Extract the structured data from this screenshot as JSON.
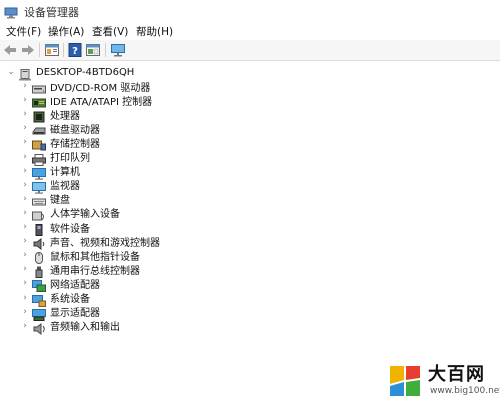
{
  "window": {
    "title": "设备管理器"
  },
  "menu": [
    "文件(F)",
    "操作(A)",
    "查看(V)",
    "帮助(H)"
  ],
  "toolbar": [
    "back-arrow-icon",
    "forward-arrow-icon",
    "properties-icon",
    "help-icon",
    "show-hide-icon",
    "monitor-icon"
  ],
  "tree": {
    "root": "DESKTOP-4BTD6QH",
    "items": [
      {
        "label": "DVD/CD-ROM 驱动器",
        "icon": "dvd-drive-icon"
      },
      {
        "label": "IDE ATA/ATAPI 控制器",
        "icon": "ide-controller-icon"
      },
      {
        "label": "处理器",
        "icon": "processor-icon"
      },
      {
        "label": "磁盘驱动器",
        "icon": "disk-drive-icon"
      },
      {
        "label": "存储控制器",
        "icon": "storage-controller-icon"
      },
      {
        "label": "打印队列",
        "icon": "printer-icon"
      },
      {
        "label": "计算机",
        "icon": "computer-icon"
      },
      {
        "label": "监视器",
        "icon": "monitor-icon"
      },
      {
        "label": "键盘",
        "icon": "keyboard-icon"
      },
      {
        "label": "人体学输入设备",
        "icon": "hid-icon"
      },
      {
        "label": "软件设备",
        "icon": "software-device-icon"
      },
      {
        "label": "声音、视频和游戏控制器",
        "icon": "speaker-icon"
      },
      {
        "label": "鼠标和其他指针设备",
        "icon": "mouse-icon"
      },
      {
        "label": "通用串行总线控制器",
        "icon": "usb-icon"
      },
      {
        "label": "网络适配器",
        "icon": "network-adapter-icon"
      },
      {
        "label": "系统设备",
        "icon": "system-device-icon"
      },
      {
        "label": "显示适配器",
        "icon": "display-adapter-icon"
      },
      {
        "label": "音频输入和输出",
        "icon": "audio-io-icon"
      }
    ]
  },
  "watermark": {
    "name": "大百网",
    "url": "www.big100.net"
  }
}
